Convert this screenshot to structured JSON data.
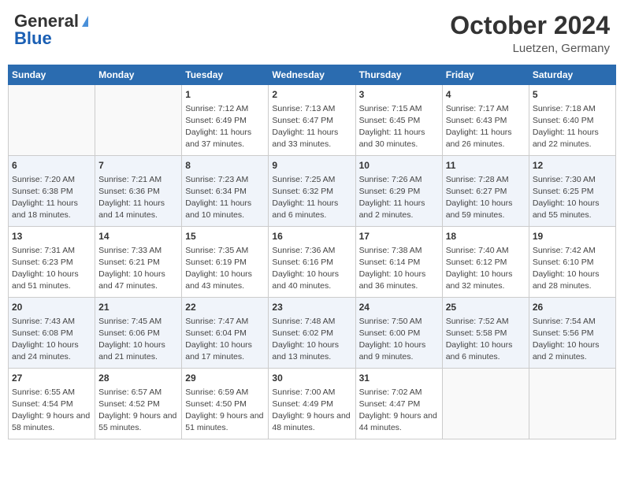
{
  "header": {
    "logo_general": "General",
    "logo_blue": "Blue",
    "month_title": "October 2024",
    "location": "Luetzen, Germany"
  },
  "days_of_week": [
    "Sunday",
    "Monday",
    "Tuesday",
    "Wednesday",
    "Thursday",
    "Friday",
    "Saturday"
  ],
  "weeks": [
    [
      {
        "day": "",
        "info": ""
      },
      {
        "day": "",
        "info": ""
      },
      {
        "day": "1",
        "info": "Sunrise: 7:12 AM\nSunset: 6:49 PM\nDaylight: 11 hours and 37 minutes."
      },
      {
        "day": "2",
        "info": "Sunrise: 7:13 AM\nSunset: 6:47 PM\nDaylight: 11 hours and 33 minutes."
      },
      {
        "day": "3",
        "info": "Sunrise: 7:15 AM\nSunset: 6:45 PM\nDaylight: 11 hours and 30 minutes."
      },
      {
        "day": "4",
        "info": "Sunrise: 7:17 AM\nSunset: 6:43 PM\nDaylight: 11 hours and 26 minutes."
      },
      {
        "day": "5",
        "info": "Sunrise: 7:18 AM\nSunset: 6:40 PM\nDaylight: 11 hours and 22 minutes."
      }
    ],
    [
      {
        "day": "6",
        "info": "Sunrise: 7:20 AM\nSunset: 6:38 PM\nDaylight: 11 hours and 18 minutes."
      },
      {
        "day": "7",
        "info": "Sunrise: 7:21 AM\nSunset: 6:36 PM\nDaylight: 11 hours and 14 minutes."
      },
      {
        "day": "8",
        "info": "Sunrise: 7:23 AM\nSunset: 6:34 PM\nDaylight: 11 hours and 10 minutes."
      },
      {
        "day": "9",
        "info": "Sunrise: 7:25 AM\nSunset: 6:32 PM\nDaylight: 11 hours and 6 minutes."
      },
      {
        "day": "10",
        "info": "Sunrise: 7:26 AM\nSunset: 6:29 PM\nDaylight: 11 hours and 2 minutes."
      },
      {
        "day": "11",
        "info": "Sunrise: 7:28 AM\nSunset: 6:27 PM\nDaylight: 10 hours and 59 minutes."
      },
      {
        "day": "12",
        "info": "Sunrise: 7:30 AM\nSunset: 6:25 PM\nDaylight: 10 hours and 55 minutes."
      }
    ],
    [
      {
        "day": "13",
        "info": "Sunrise: 7:31 AM\nSunset: 6:23 PM\nDaylight: 10 hours and 51 minutes."
      },
      {
        "day": "14",
        "info": "Sunrise: 7:33 AM\nSunset: 6:21 PM\nDaylight: 10 hours and 47 minutes."
      },
      {
        "day": "15",
        "info": "Sunrise: 7:35 AM\nSunset: 6:19 PM\nDaylight: 10 hours and 43 minutes."
      },
      {
        "day": "16",
        "info": "Sunrise: 7:36 AM\nSunset: 6:16 PM\nDaylight: 10 hours and 40 minutes."
      },
      {
        "day": "17",
        "info": "Sunrise: 7:38 AM\nSunset: 6:14 PM\nDaylight: 10 hours and 36 minutes."
      },
      {
        "day": "18",
        "info": "Sunrise: 7:40 AM\nSunset: 6:12 PM\nDaylight: 10 hours and 32 minutes."
      },
      {
        "day": "19",
        "info": "Sunrise: 7:42 AM\nSunset: 6:10 PM\nDaylight: 10 hours and 28 minutes."
      }
    ],
    [
      {
        "day": "20",
        "info": "Sunrise: 7:43 AM\nSunset: 6:08 PM\nDaylight: 10 hours and 24 minutes."
      },
      {
        "day": "21",
        "info": "Sunrise: 7:45 AM\nSunset: 6:06 PM\nDaylight: 10 hours and 21 minutes."
      },
      {
        "day": "22",
        "info": "Sunrise: 7:47 AM\nSunset: 6:04 PM\nDaylight: 10 hours and 17 minutes."
      },
      {
        "day": "23",
        "info": "Sunrise: 7:48 AM\nSunset: 6:02 PM\nDaylight: 10 hours and 13 minutes."
      },
      {
        "day": "24",
        "info": "Sunrise: 7:50 AM\nSunset: 6:00 PM\nDaylight: 10 hours and 9 minutes."
      },
      {
        "day": "25",
        "info": "Sunrise: 7:52 AM\nSunset: 5:58 PM\nDaylight: 10 hours and 6 minutes."
      },
      {
        "day": "26",
        "info": "Sunrise: 7:54 AM\nSunset: 5:56 PM\nDaylight: 10 hours and 2 minutes."
      }
    ],
    [
      {
        "day": "27",
        "info": "Sunrise: 6:55 AM\nSunset: 4:54 PM\nDaylight: 9 hours and 58 minutes."
      },
      {
        "day": "28",
        "info": "Sunrise: 6:57 AM\nSunset: 4:52 PM\nDaylight: 9 hours and 55 minutes."
      },
      {
        "day": "29",
        "info": "Sunrise: 6:59 AM\nSunset: 4:50 PM\nDaylight: 9 hours and 51 minutes."
      },
      {
        "day": "30",
        "info": "Sunrise: 7:00 AM\nSunset: 4:49 PM\nDaylight: 9 hours and 48 minutes."
      },
      {
        "day": "31",
        "info": "Sunrise: 7:02 AM\nSunset: 4:47 PM\nDaylight: 9 hours and 44 minutes."
      },
      {
        "day": "",
        "info": ""
      },
      {
        "day": "",
        "info": ""
      }
    ]
  ]
}
